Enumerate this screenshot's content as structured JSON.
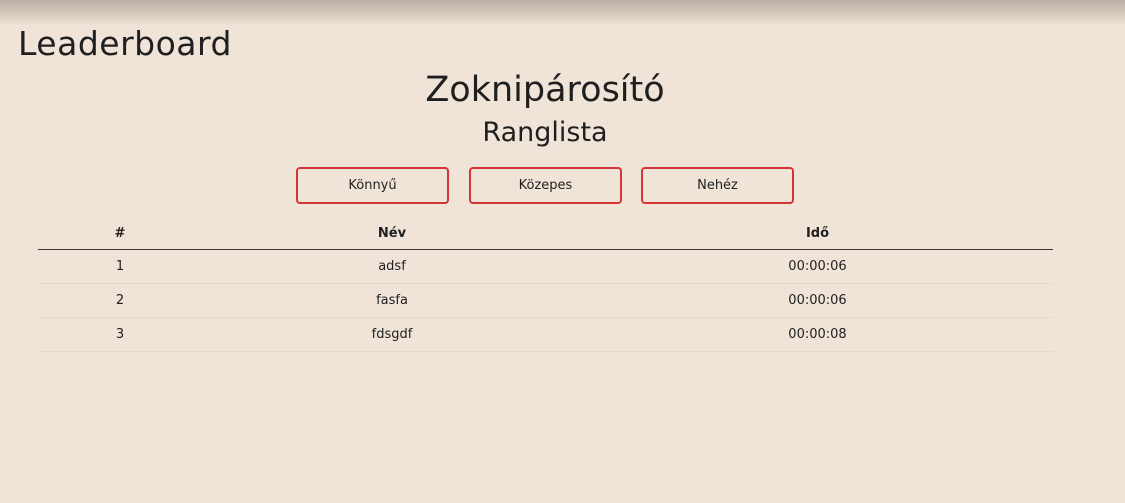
{
  "app": {
    "title": "Leaderboard"
  },
  "page": {
    "title": "Zoknipárosító",
    "subtitle": "Ranglista"
  },
  "difficulty": {
    "tabs": [
      {
        "label": "Könnyű"
      },
      {
        "label": "Közepes"
      },
      {
        "label": "Nehéz"
      }
    ],
    "accent_color": "#d63535"
  },
  "table": {
    "headers": {
      "rank": "#",
      "name": "Név",
      "time": "Idő"
    },
    "rows": [
      {
        "rank": "1",
        "name": "adsf",
        "time": "00:00:06"
      },
      {
        "rank": "2",
        "name": "fasfa",
        "time": "00:00:06"
      },
      {
        "rank": "3",
        "name": "fdsgdf",
        "time": "00:00:08"
      }
    ]
  }
}
